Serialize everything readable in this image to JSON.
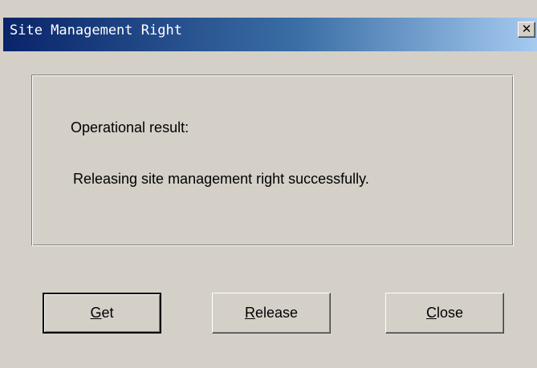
{
  "window": {
    "title": "Site Management Right",
    "close_glyph": "✕"
  },
  "content": {
    "result_label": "Operational result:",
    "result_message": "Releasing site management right successfully."
  },
  "buttons": {
    "get": {
      "mnemonic": "G",
      "rest": "et"
    },
    "release": {
      "mnemonic": "R",
      "rest": "elease"
    },
    "close": {
      "mnemonic": "C",
      "rest": "lose"
    }
  },
  "colors": {
    "title_gradient_start": "#0a246a",
    "title_gradient_end": "#a6caf0",
    "face": "#d4d0c8"
  }
}
